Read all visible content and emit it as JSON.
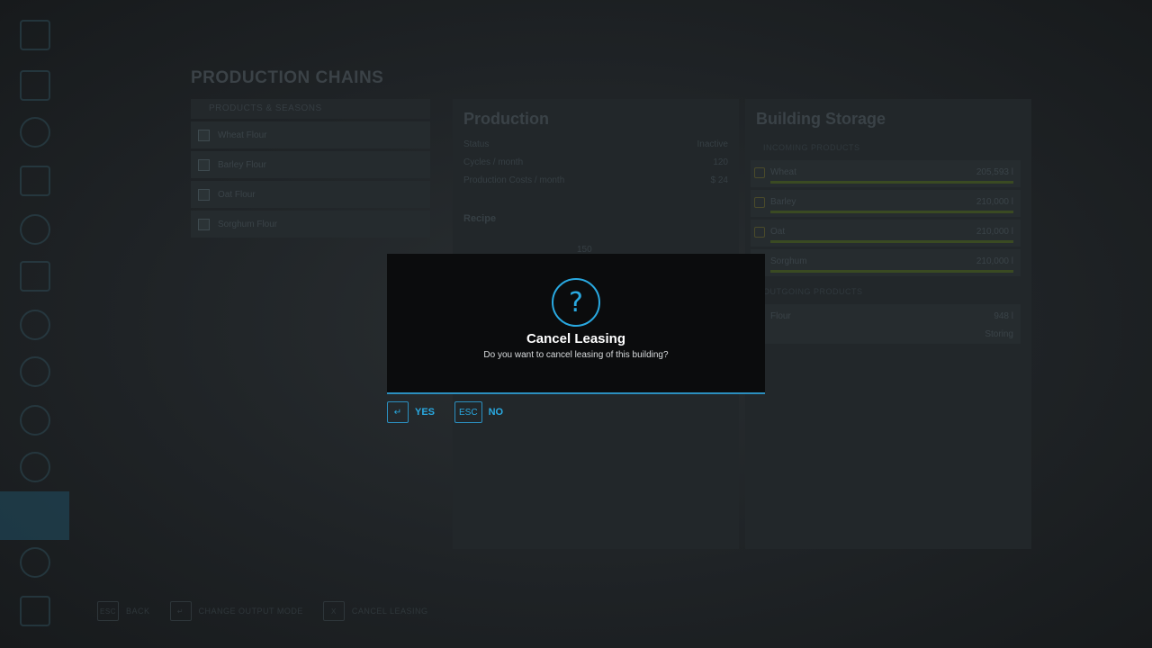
{
  "background": {
    "page_title": "PRODUCTION CHAINS",
    "chains_header": "PRODUCTS & SEASONS",
    "chains": [
      "Wheat Flour",
      "Barley Flour",
      "Oat Flour",
      "Sorghum Flour"
    ],
    "production": {
      "title": "Production",
      "rows": [
        {
          "label": "Status",
          "value": "Inactive"
        },
        {
          "label": "Cycles / month",
          "value": "120"
        },
        {
          "label": "Production Costs / month",
          "value": "$ 24"
        }
      ],
      "recipe_label": "Recipe",
      "recipe_amount": "150"
    },
    "storage": {
      "title": "Building Storage",
      "input_header": "INCOMING PRODUCTS",
      "inputs": [
        {
          "name": "Wheat",
          "amount": "205,593 l"
        },
        {
          "name": "Barley",
          "amount": "210,000 l"
        },
        {
          "name": "Oat",
          "amount": "210,000 l"
        },
        {
          "name": "Sorghum",
          "amount": "210,000 l"
        }
      ],
      "output_header": "OUTGOING PRODUCTS",
      "outputs": [
        {
          "name": "Flour",
          "amount": "948 l",
          "mode": "Storing"
        }
      ]
    },
    "bottom_actions": [
      {
        "key": "ESC",
        "label": "BACK"
      },
      {
        "key": "↵",
        "label": "CHANGE OUTPUT MODE"
      },
      {
        "key": "X",
        "label": "CANCEL LEASING"
      }
    ]
  },
  "dialog": {
    "icon": "question-icon",
    "icon_glyph": "?",
    "title": "Cancel Leasing",
    "message": "Do you want to cancel leasing of this building?",
    "accent_color": "#29a9e1"
  },
  "actions": {
    "yes": {
      "key": "↵",
      "label": "YES"
    },
    "no": {
      "key": "ESC",
      "label": "NO"
    }
  }
}
